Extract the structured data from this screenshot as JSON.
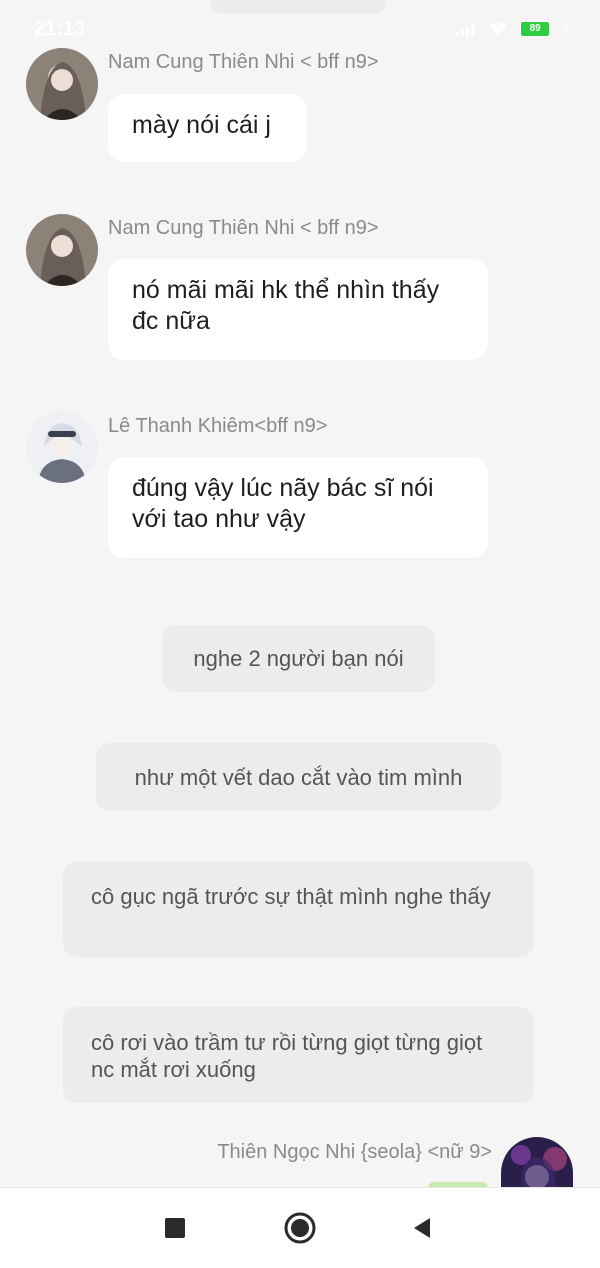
{
  "status_bar": {
    "time": "21:13",
    "battery": "89"
  },
  "messages": [
    {
      "sender": "Nam Cung Thiên Nhi < bff n9>",
      "text": "mày nói cái j"
    },
    {
      "sender": "Nam Cung Thiên Nhi < bff n9>",
      "text": "nó mãi mãi hk thể nhìn thấy đc nữa"
    },
    {
      "sender": "Lê Thanh Khiêm<bff n9>",
      "text": "đúng vậy lúc nãy bác sĩ nói với tao như vậy"
    }
  ],
  "narrations": [
    "nghe 2 người bạn nói",
    "như một vết dao cắt vào tim mình",
    "cô gục ngã trước sự thật mình nghe thấy",
    "cô rơi vào trầm tư rồi từng giọt từng giọt nc mắt rơi xuống"
  ],
  "last_sender": "Thiên Ngọc Nhi {seola} <nữ 9>",
  "icons": {
    "avatar_1": "avatar-girl-icon",
    "avatar_2": "avatar-boy-icon",
    "avatar_3": "avatar-girl-purple-icon",
    "nav_recent": "square-icon",
    "nav_home": "circle-icon",
    "nav_back": "triangle-back-icon"
  },
  "colors": {
    "background": "#f5f5f5",
    "bubble": "#ffffff",
    "narration": "#ececec",
    "battery": "#2ecc40"
  }
}
